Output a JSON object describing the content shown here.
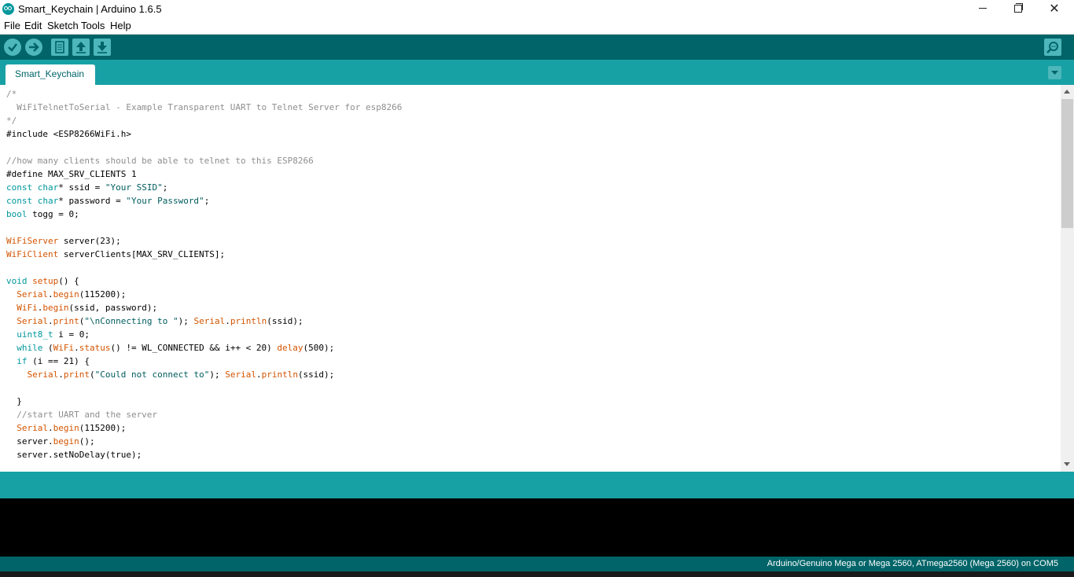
{
  "window": {
    "title": "Smart_Keychain | Arduino 1.6.5",
    "minimize_glyph": "",
    "close_glyph": "✕"
  },
  "menu": [
    "File",
    "Edit",
    "Sketch",
    "Tools",
    "Help"
  ],
  "toolbar": {
    "buttons": [
      "verify-icon",
      "upload-icon",
      "new-icon",
      "open-icon",
      "save-icon",
      "serial-monitor-icon"
    ]
  },
  "tabs": [
    {
      "label": "Smart_Keychain"
    }
  ],
  "colors": {
    "toolbar": "#006468",
    "tabstrip": "#17a1a5",
    "keyword": "#00979c",
    "function": "#d35400",
    "comment": "#8e8e8e",
    "string": "#005c5f"
  },
  "code": [
    [
      [
        "c",
        "/*"
      ]
    ],
    [
      [
        "c",
        "  WiFiTelnetToSerial - Example Transparent UART to Telnet Server for esp8266"
      ]
    ],
    [
      [
        "c",
        "*/"
      ]
    ],
    [
      [
        "n",
        "#include <ESP8266WiFi.h>"
      ]
    ],
    [
      [
        "n",
        ""
      ]
    ],
    [
      [
        "c",
        "//how many clients should be able to telnet to this ESP8266"
      ]
    ],
    [
      [
        "n",
        "#define MAX_SRV_CLIENTS 1"
      ]
    ],
    [
      [
        "k",
        "const"
      ],
      [
        "n",
        " "
      ],
      [
        "k",
        "char"
      ],
      [
        "n",
        "* ssid = "
      ],
      [
        "s",
        "\"Your SSID\""
      ],
      [
        "n",
        ";"
      ]
    ],
    [
      [
        "k",
        "const"
      ],
      [
        "n",
        " "
      ],
      [
        "k",
        "char"
      ],
      [
        "n",
        "* password = "
      ],
      [
        "s",
        "\"Your Password\""
      ],
      [
        "n",
        ";"
      ]
    ],
    [
      [
        "k",
        "bool"
      ],
      [
        "n",
        " togg = 0;"
      ]
    ],
    [
      [
        "n",
        ""
      ]
    ],
    [
      [
        "f",
        "WiFiServer"
      ],
      [
        "n",
        " server(23);"
      ]
    ],
    [
      [
        "f",
        "WiFiClient"
      ],
      [
        "n",
        " serverClients[MAX_SRV_CLIENTS];"
      ]
    ],
    [
      [
        "n",
        ""
      ]
    ],
    [
      [
        "k",
        "void"
      ],
      [
        "n",
        " "
      ],
      [
        "f",
        "setup"
      ],
      [
        "n",
        "() {"
      ]
    ],
    [
      [
        "n",
        "  "
      ],
      [
        "f",
        "Serial"
      ],
      [
        "n",
        "."
      ],
      [
        "f",
        "begin"
      ],
      [
        "n",
        "(115200);"
      ]
    ],
    [
      [
        "n",
        "  "
      ],
      [
        "f",
        "WiFi"
      ],
      [
        "n",
        "."
      ],
      [
        "f",
        "begin"
      ],
      [
        "n",
        "(ssid, password);"
      ]
    ],
    [
      [
        "n",
        "  "
      ],
      [
        "f",
        "Serial"
      ],
      [
        "n",
        "."
      ],
      [
        "f",
        "print"
      ],
      [
        "n",
        "("
      ],
      [
        "s",
        "\"\\nConnecting to \""
      ],
      [
        "n",
        "); "
      ],
      [
        "f",
        "Serial"
      ],
      [
        "n",
        "."
      ],
      [
        "f",
        "println"
      ],
      [
        "n",
        "(ssid);"
      ]
    ],
    [
      [
        "n",
        "  "
      ],
      [
        "k",
        "uint8_t"
      ],
      [
        "n",
        " i = 0;"
      ]
    ],
    [
      [
        "n",
        "  "
      ],
      [
        "k",
        "while"
      ],
      [
        "n",
        " ("
      ],
      [
        "f",
        "WiFi"
      ],
      [
        "n",
        "."
      ],
      [
        "f",
        "status"
      ],
      [
        "n",
        "() != WL_CONNECTED && i++ < 20) "
      ],
      [
        "f",
        "delay"
      ],
      [
        "n",
        "(500);"
      ]
    ],
    [
      [
        "n",
        "  "
      ],
      [
        "k",
        "if"
      ],
      [
        "n",
        " (i == 21) {"
      ]
    ],
    [
      [
        "n",
        "    "
      ],
      [
        "f",
        "Serial"
      ],
      [
        "n",
        "."
      ],
      [
        "f",
        "print"
      ],
      [
        "n",
        "("
      ],
      [
        "s",
        "\"Could not connect to\""
      ],
      [
        "n",
        "); "
      ],
      [
        "f",
        "Serial"
      ],
      [
        "n",
        "."
      ],
      [
        "f",
        "println"
      ],
      [
        "n",
        "(ssid);"
      ]
    ],
    [
      [
        "n",
        ""
      ]
    ],
    [
      [
        "n",
        "  }"
      ]
    ],
    [
      [
        "c",
        "  //start UART and the server"
      ]
    ],
    [
      [
        "n",
        "  "
      ],
      [
        "f",
        "Serial"
      ],
      [
        "n",
        "."
      ],
      [
        "f",
        "begin"
      ],
      [
        "n",
        "(115200);"
      ]
    ],
    [
      [
        "n",
        "  server."
      ],
      [
        "f",
        "begin"
      ],
      [
        "n",
        "();"
      ]
    ],
    [
      [
        "n",
        "  server.setNoDelay(true);"
      ]
    ]
  ],
  "footer": {
    "board": "Arduino/Genuino Mega or Mega 2560, ATmega2560 (Mega 2560) on COM5"
  }
}
